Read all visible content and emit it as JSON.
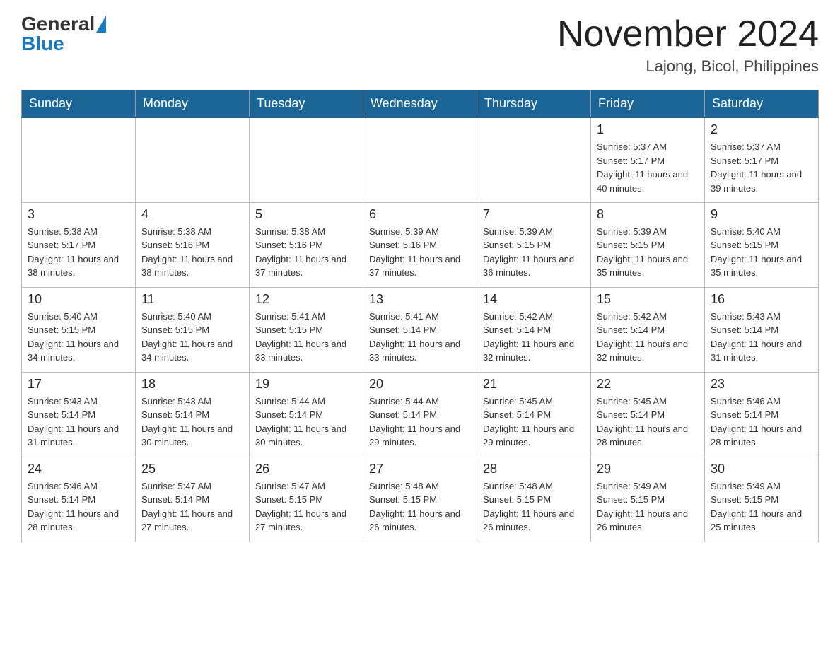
{
  "header": {
    "logo_general": "General",
    "logo_blue": "Blue",
    "month_title": "November 2024",
    "location": "Lajong, Bicol, Philippines"
  },
  "days_of_week": [
    "Sunday",
    "Monday",
    "Tuesday",
    "Wednesday",
    "Thursday",
    "Friday",
    "Saturday"
  ],
  "weeks": [
    [
      {
        "day": "",
        "sunrise": "",
        "sunset": "",
        "daylight": ""
      },
      {
        "day": "",
        "sunrise": "",
        "sunset": "",
        "daylight": ""
      },
      {
        "day": "",
        "sunrise": "",
        "sunset": "",
        "daylight": ""
      },
      {
        "day": "",
        "sunrise": "",
        "sunset": "",
        "daylight": ""
      },
      {
        "day": "",
        "sunrise": "",
        "sunset": "",
        "daylight": ""
      },
      {
        "day": "1",
        "sunrise": "Sunrise: 5:37 AM",
        "sunset": "Sunset: 5:17 PM",
        "daylight": "Daylight: 11 hours and 40 minutes."
      },
      {
        "day": "2",
        "sunrise": "Sunrise: 5:37 AM",
        "sunset": "Sunset: 5:17 PM",
        "daylight": "Daylight: 11 hours and 39 minutes."
      }
    ],
    [
      {
        "day": "3",
        "sunrise": "Sunrise: 5:38 AM",
        "sunset": "Sunset: 5:17 PM",
        "daylight": "Daylight: 11 hours and 38 minutes."
      },
      {
        "day": "4",
        "sunrise": "Sunrise: 5:38 AM",
        "sunset": "Sunset: 5:16 PM",
        "daylight": "Daylight: 11 hours and 38 minutes."
      },
      {
        "day": "5",
        "sunrise": "Sunrise: 5:38 AM",
        "sunset": "Sunset: 5:16 PM",
        "daylight": "Daylight: 11 hours and 37 minutes."
      },
      {
        "day": "6",
        "sunrise": "Sunrise: 5:39 AM",
        "sunset": "Sunset: 5:16 PM",
        "daylight": "Daylight: 11 hours and 37 minutes."
      },
      {
        "day": "7",
        "sunrise": "Sunrise: 5:39 AM",
        "sunset": "Sunset: 5:15 PM",
        "daylight": "Daylight: 11 hours and 36 minutes."
      },
      {
        "day": "8",
        "sunrise": "Sunrise: 5:39 AM",
        "sunset": "Sunset: 5:15 PM",
        "daylight": "Daylight: 11 hours and 35 minutes."
      },
      {
        "day": "9",
        "sunrise": "Sunrise: 5:40 AM",
        "sunset": "Sunset: 5:15 PM",
        "daylight": "Daylight: 11 hours and 35 minutes."
      }
    ],
    [
      {
        "day": "10",
        "sunrise": "Sunrise: 5:40 AM",
        "sunset": "Sunset: 5:15 PM",
        "daylight": "Daylight: 11 hours and 34 minutes."
      },
      {
        "day": "11",
        "sunrise": "Sunrise: 5:40 AM",
        "sunset": "Sunset: 5:15 PM",
        "daylight": "Daylight: 11 hours and 34 minutes."
      },
      {
        "day": "12",
        "sunrise": "Sunrise: 5:41 AM",
        "sunset": "Sunset: 5:15 PM",
        "daylight": "Daylight: 11 hours and 33 minutes."
      },
      {
        "day": "13",
        "sunrise": "Sunrise: 5:41 AM",
        "sunset": "Sunset: 5:14 PM",
        "daylight": "Daylight: 11 hours and 33 minutes."
      },
      {
        "day": "14",
        "sunrise": "Sunrise: 5:42 AM",
        "sunset": "Sunset: 5:14 PM",
        "daylight": "Daylight: 11 hours and 32 minutes."
      },
      {
        "day": "15",
        "sunrise": "Sunrise: 5:42 AM",
        "sunset": "Sunset: 5:14 PM",
        "daylight": "Daylight: 11 hours and 32 minutes."
      },
      {
        "day": "16",
        "sunrise": "Sunrise: 5:43 AM",
        "sunset": "Sunset: 5:14 PM",
        "daylight": "Daylight: 11 hours and 31 minutes."
      }
    ],
    [
      {
        "day": "17",
        "sunrise": "Sunrise: 5:43 AM",
        "sunset": "Sunset: 5:14 PM",
        "daylight": "Daylight: 11 hours and 31 minutes."
      },
      {
        "day": "18",
        "sunrise": "Sunrise: 5:43 AM",
        "sunset": "Sunset: 5:14 PM",
        "daylight": "Daylight: 11 hours and 30 minutes."
      },
      {
        "day": "19",
        "sunrise": "Sunrise: 5:44 AM",
        "sunset": "Sunset: 5:14 PM",
        "daylight": "Daylight: 11 hours and 30 minutes."
      },
      {
        "day": "20",
        "sunrise": "Sunrise: 5:44 AM",
        "sunset": "Sunset: 5:14 PM",
        "daylight": "Daylight: 11 hours and 29 minutes."
      },
      {
        "day": "21",
        "sunrise": "Sunrise: 5:45 AM",
        "sunset": "Sunset: 5:14 PM",
        "daylight": "Daylight: 11 hours and 29 minutes."
      },
      {
        "day": "22",
        "sunrise": "Sunrise: 5:45 AM",
        "sunset": "Sunset: 5:14 PM",
        "daylight": "Daylight: 11 hours and 28 minutes."
      },
      {
        "day": "23",
        "sunrise": "Sunrise: 5:46 AM",
        "sunset": "Sunset: 5:14 PM",
        "daylight": "Daylight: 11 hours and 28 minutes."
      }
    ],
    [
      {
        "day": "24",
        "sunrise": "Sunrise: 5:46 AM",
        "sunset": "Sunset: 5:14 PM",
        "daylight": "Daylight: 11 hours and 28 minutes."
      },
      {
        "day": "25",
        "sunrise": "Sunrise: 5:47 AM",
        "sunset": "Sunset: 5:14 PM",
        "daylight": "Daylight: 11 hours and 27 minutes."
      },
      {
        "day": "26",
        "sunrise": "Sunrise: 5:47 AM",
        "sunset": "Sunset: 5:15 PM",
        "daylight": "Daylight: 11 hours and 27 minutes."
      },
      {
        "day": "27",
        "sunrise": "Sunrise: 5:48 AM",
        "sunset": "Sunset: 5:15 PM",
        "daylight": "Daylight: 11 hours and 26 minutes."
      },
      {
        "day": "28",
        "sunrise": "Sunrise: 5:48 AM",
        "sunset": "Sunset: 5:15 PM",
        "daylight": "Daylight: 11 hours and 26 minutes."
      },
      {
        "day": "29",
        "sunrise": "Sunrise: 5:49 AM",
        "sunset": "Sunset: 5:15 PM",
        "daylight": "Daylight: 11 hours and 26 minutes."
      },
      {
        "day": "30",
        "sunrise": "Sunrise: 5:49 AM",
        "sunset": "Sunset: 5:15 PM",
        "daylight": "Daylight: 11 hours and 25 minutes."
      }
    ]
  ]
}
